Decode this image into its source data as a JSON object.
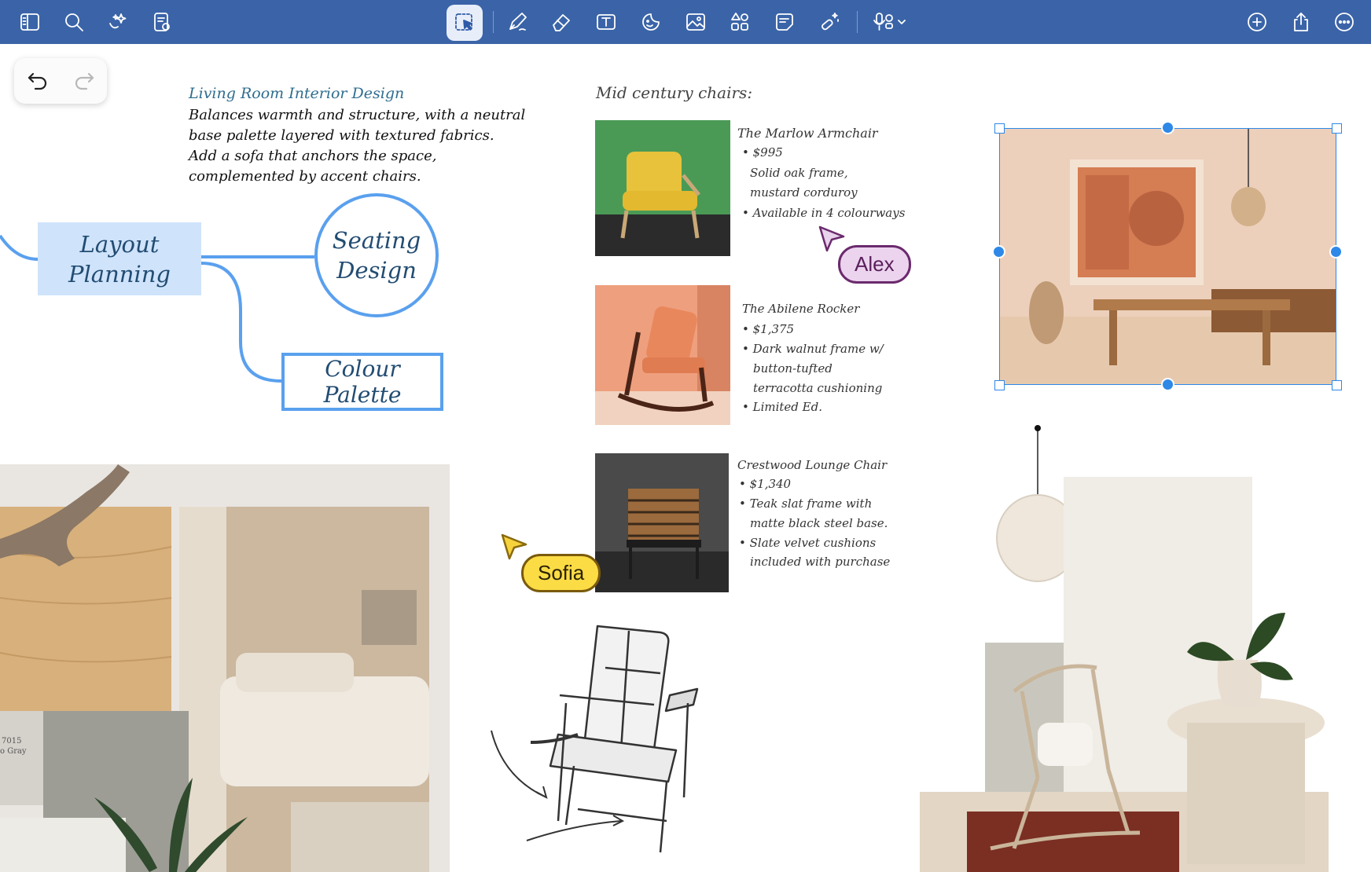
{
  "toolbar": {
    "left_icons": [
      "sidebar-icon",
      "search-icon",
      "sparkle-icon",
      "page-settings-icon"
    ],
    "center_icons": [
      "selection-icon",
      "pen-icon",
      "eraser-icon",
      "text-box-icon",
      "sticker-icon",
      "image-icon",
      "shapes-icon",
      "sticky-note-icon",
      "magic-wand-icon",
      "voice-icon"
    ],
    "right_icons": [
      "add-icon",
      "share-icon",
      "more-icon"
    ],
    "accent": "#3b64a8"
  },
  "note": {
    "title": "Living Room Interior Design",
    "body": "Balances warmth and structure, with a neutral base palette layered with textured fabrics. Add a sofa that anchors the space, complemented by accent chairs."
  },
  "mindmap": {
    "layout": "Layout Planning",
    "seating": "Seating Design",
    "colour": "Colour Palette"
  },
  "chairs": {
    "heading": "Mid century chairs:",
    "items": [
      {
        "name": "The Marlow Armchair",
        "lines": [
          "• $995",
          "Solid oak frame,",
          "mustard corduroy",
          "• Available in 4 colourways"
        ]
      },
      {
        "name": "The Abilene Rocker",
        "lines": [
          "• $1,375",
          "• Dark walnut frame w/",
          "button-tufted",
          "terracotta cushioning",
          "• Limited Ed."
        ]
      },
      {
        "name": "Crestwood Lounge Chair",
        "lines": [
          "• $1,340",
          "• Teak slat frame with",
          "matte black steel base.",
          "• Slate velvet cushions",
          "included with purchase"
        ]
      }
    ]
  },
  "collaborators": {
    "alex": "Alex",
    "sofia": "Sofia"
  },
  "swatch": {
    "code": "7015",
    "name": "o Gray"
  }
}
